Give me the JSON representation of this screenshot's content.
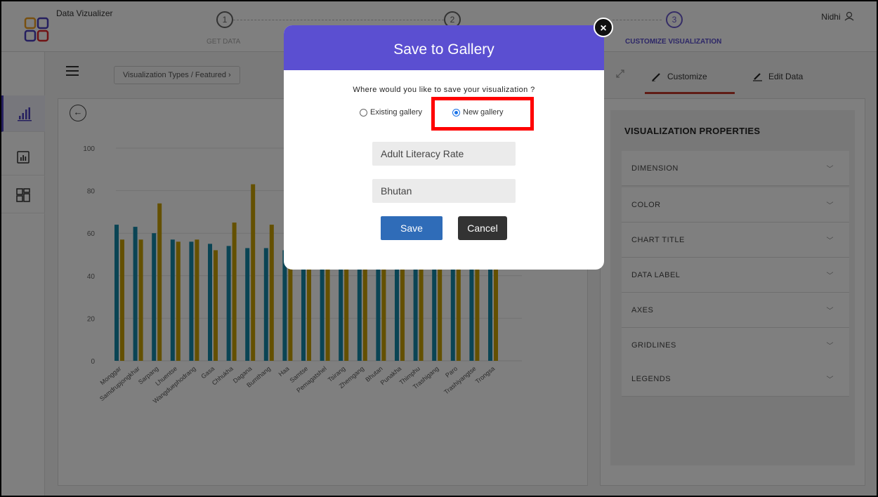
{
  "app": {
    "title": "Data Vizualizer"
  },
  "steps": [
    {
      "number": "1",
      "label": "GET DATA"
    },
    {
      "number": "2",
      "label": ""
    },
    {
      "number": "3",
      "label": "CUSTOMIZE VISUALIZATION"
    }
  ],
  "user": {
    "name": "Nidhi"
  },
  "toolbar": {
    "breadcrumb": "Visualization Types / Featured  ›",
    "tabs": [
      {
        "label": "Customize"
      },
      {
        "label": "Edit Data"
      }
    ]
  },
  "properties": {
    "title": "VISUALIZATION PROPERTIES",
    "items": [
      {
        "label": "DIMENSION"
      },
      {
        "label": "COLOR"
      },
      {
        "label": "CHART TITLE"
      },
      {
        "label": "DATA LABEL"
      },
      {
        "label": "AXES"
      },
      {
        "label": "GRIDLINES"
      },
      {
        "label": "LEGENDS"
      }
    ]
  },
  "chart_data": {
    "type": "bar",
    "categories": [
      "Monggar",
      "Samdrupjongkhar",
      "Sarpang",
      "Lhuentse",
      "Wangduephodrang",
      "Gasa",
      "Chhukha",
      "Dagana",
      "Bumthang",
      "Haa",
      "Samtse",
      "Pemagatshel",
      "Tsirang",
      "Zhemgang",
      "Bhutan",
      "Punakha",
      "Thimphu",
      "Trashigang",
      "Paro",
      "Trashiyangtse",
      "Trongsa"
    ],
    "series": [
      {
        "color": "#1589a8",
        "values": [
          64,
          63,
          60,
          57,
          56,
          55,
          54,
          53,
          53,
          52,
          52,
          51,
          51,
          51,
          50,
          50,
          50,
          50,
          50,
          50,
          50
        ]
      },
      {
        "color": "#c9a000",
        "values": [
          57,
          57,
          74,
          56,
          57,
          52,
          65,
          83,
          64,
          52,
          52,
          51,
          51,
          51,
          50,
          50,
          50,
          50,
          50,
          50,
          50
        ]
      }
    ],
    "ylim": [
      0,
      100
    ],
    "yticks": [
      0,
      20,
      40,
      60,
      80,
      100
    ]
  },
  "modal": {
    "title": "Save to Gallery",
    "question": "Where would you like to save your visualization ?",
    "options": {
      "existing": "Existing gallery",
      "new": "New gallery",
      "selected": "new"
    },
    "fields": {
      "name": "Adult Literacy Rate",
      "gallery": "Bhutan"
    },
    "save_label": "Save",
    "cancel_label": "Cancel",
    "close_label": "×"
  }
}
